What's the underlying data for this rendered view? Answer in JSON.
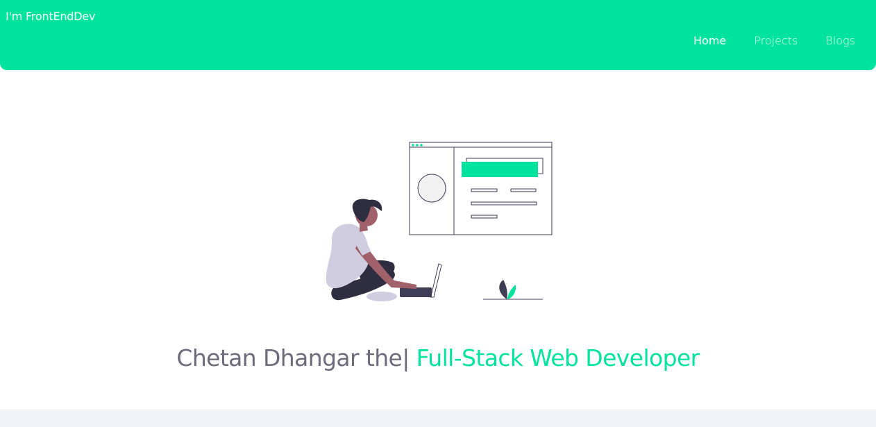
{
  "navbar": {
    "brand": "I'm FrontEndDev",
    "links": [
      {
        "label": "Home",
        "active": true
      },
      {
        "label": "Projects",
        "active": false
      },
      {
        "label": "Blogs",
        "active": false
      }
    ],
    "background": "#00e39c"
  },
  "hero": {
    "illustration": "developer-with-laptop-illustration",
    "title": {
      "name_prefix": "Chetan Dhangar the",
      "cursor": "|",
      "role": " Full-Stack Web Developer"
    },
    "accent_color": "#00e39c",
    "text_color": "#6c6b7c"
  }
}
